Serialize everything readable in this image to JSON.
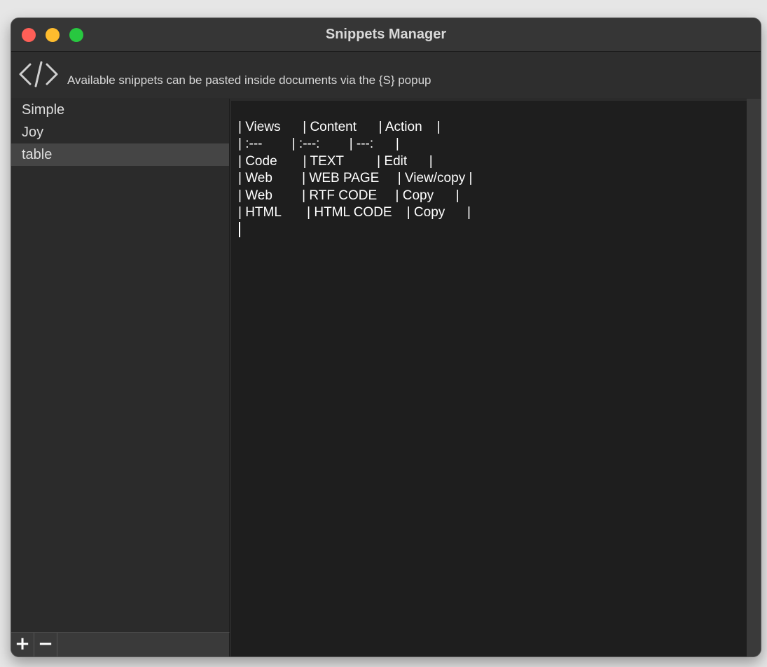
{
  "window": {
    "title": "Snippets Manager"
  },
  "infobar": {
    "icon": "code-icon",
    "text": "Available snippets can be pasted inside documents via the {S} popup"
  },
  "sidebar": {
    "items": [
      {
        "label": "Simple",
        "selected": false
      },
      {
        "label": "Joy",
        "selected": false
      },
      {
        "label": "table",
        "selected": true
      }
    ],
    "footer": {
      "add_label": "+",
      "remove_label": "−"
    }
  },
  "editor": {
    "lines": [
      "| Views      | Content      | Action    |",
      "| :---        | :---:        | ---:      |",
      "| Code       | TEXT         | Edit      |",
      "| Web        | WEB PAGE     | View/copy |",
      "| Web        | RTF CODE     | Copy      |",
      "| HTML       | HTML CODE    | Copy      |"
    ]
  },
  "colors": {
    "window_bg": "#2b2b2b",
    "editor_bg": "#1e1e1e",
    "selection": "#454545",
    "close": "#fe5f57",
    "minimize": "#febc2e",
    "maximize": "#28c840"
  }
}
